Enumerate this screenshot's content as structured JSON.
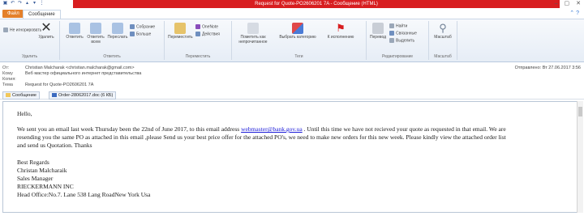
{
  "window": {
    "title": "Request for Quote-PO2606201 7A - Сообщение (HTML)",
    "quick_access": [
      "save-icon",
      "undo-icon",
      "redo-icon",
      "up-arrow-icon",
      "down-arrow-icon",
      "customize-icon"
    ],
    "controls": [
      "minimize-icon",
      "maximize-icon",
      "close-icon"
    ]
  },
  "tabs": {
    "file": "Файл",
    "message": "Сообщение"
  },
  "ribbon": {
    "delete_group": {
      "ignore": "Не игнорировать",
      "delete": "Удалить",
      "label": "Удалить"
    },
    "respond_group": {
      "reply": "Ответить",
      "reply_all": "Ответить всем",
      "forward": "Переслать",
      "meeting": "Собрание",
      "more": "Больше",
      "label": "Ответить"
    },
    "move_group": {
      "move": "Переместить",
      "onenote": "OneNote",
      "actions": "Действия",
      "label": "Переместить"
    },
    "tags_group": {
      "mark_unread": "Пометить как непрочитанное",
      "categorize": "Выбрать категорию",
      "followup": "К исполнению",
      "label": "Теги"
    },
    "edit_group": {
      "translate": "Перевод",
      "find": "Найти",
      "related": "Связанные",
      "select": "Выделить",
      "label": "Редактирование"
    },
    "zoom_group": {
      "zoom": "Масштаб",
      "label": "Масштаб"
    }
  },
  "header": {
    "from_label": "От:",
    "from_value": "Christian Malcharak <christian.malcharak@gmail.com>",
    "to_label": "Кому",
    "to_value": "Веб мастер официального интернет представительства",
    "cc_label": "Копия:",
    "cc_value": "",
    "subject_label": "Тема",
    "subject_value": "Request for Quote-PO2606201 7A",
    "sent_label": "Отправлено:",
    "sent_value": "Вт 27.06.2017 3:56"
  },
  "attachments": [
    {
      "name": "Сообщение",
      "icon": "envelope-icon"
    },
    {
      "name": "Order-28062017.doc (6 КБ)",
      "icon": "word-doc-icon"
    }
  ],
  "body": {
    "greeting": "Hello,",
    "para1_line1_pre": "We sent you an email last week Thursday been the 22nd of June 2017, to this email address ",
    "para1_link": "webmaster@bank.gov.ua",
    "para1_line1_post": " . Until this time we have not recieved your quote as requested in that email. We are",
    "para1_line2": "resending you the same PO as attached in this email ,please Send us your best price offer for the attached PO's, we need to make new orders for this new week. Please kindly view the attached order list",
    "para1_line3": "and send us Quotation. Thanks",
    "sig1": "Best Regards",
    "sig2": "Christan Malcharaik",
    "sig3": "Sales Manager",
    "sig4": "RIECKERMANN INC",
    "sig5": "Head Office:No.7. Lane 538 Lang RoadNew York Usa"
  },
  "colors": {
    "accent_file_tab": "#e4802a",
    "title_bar": "#d81e20",
    "link": "#1a1ad8"
  }
}
